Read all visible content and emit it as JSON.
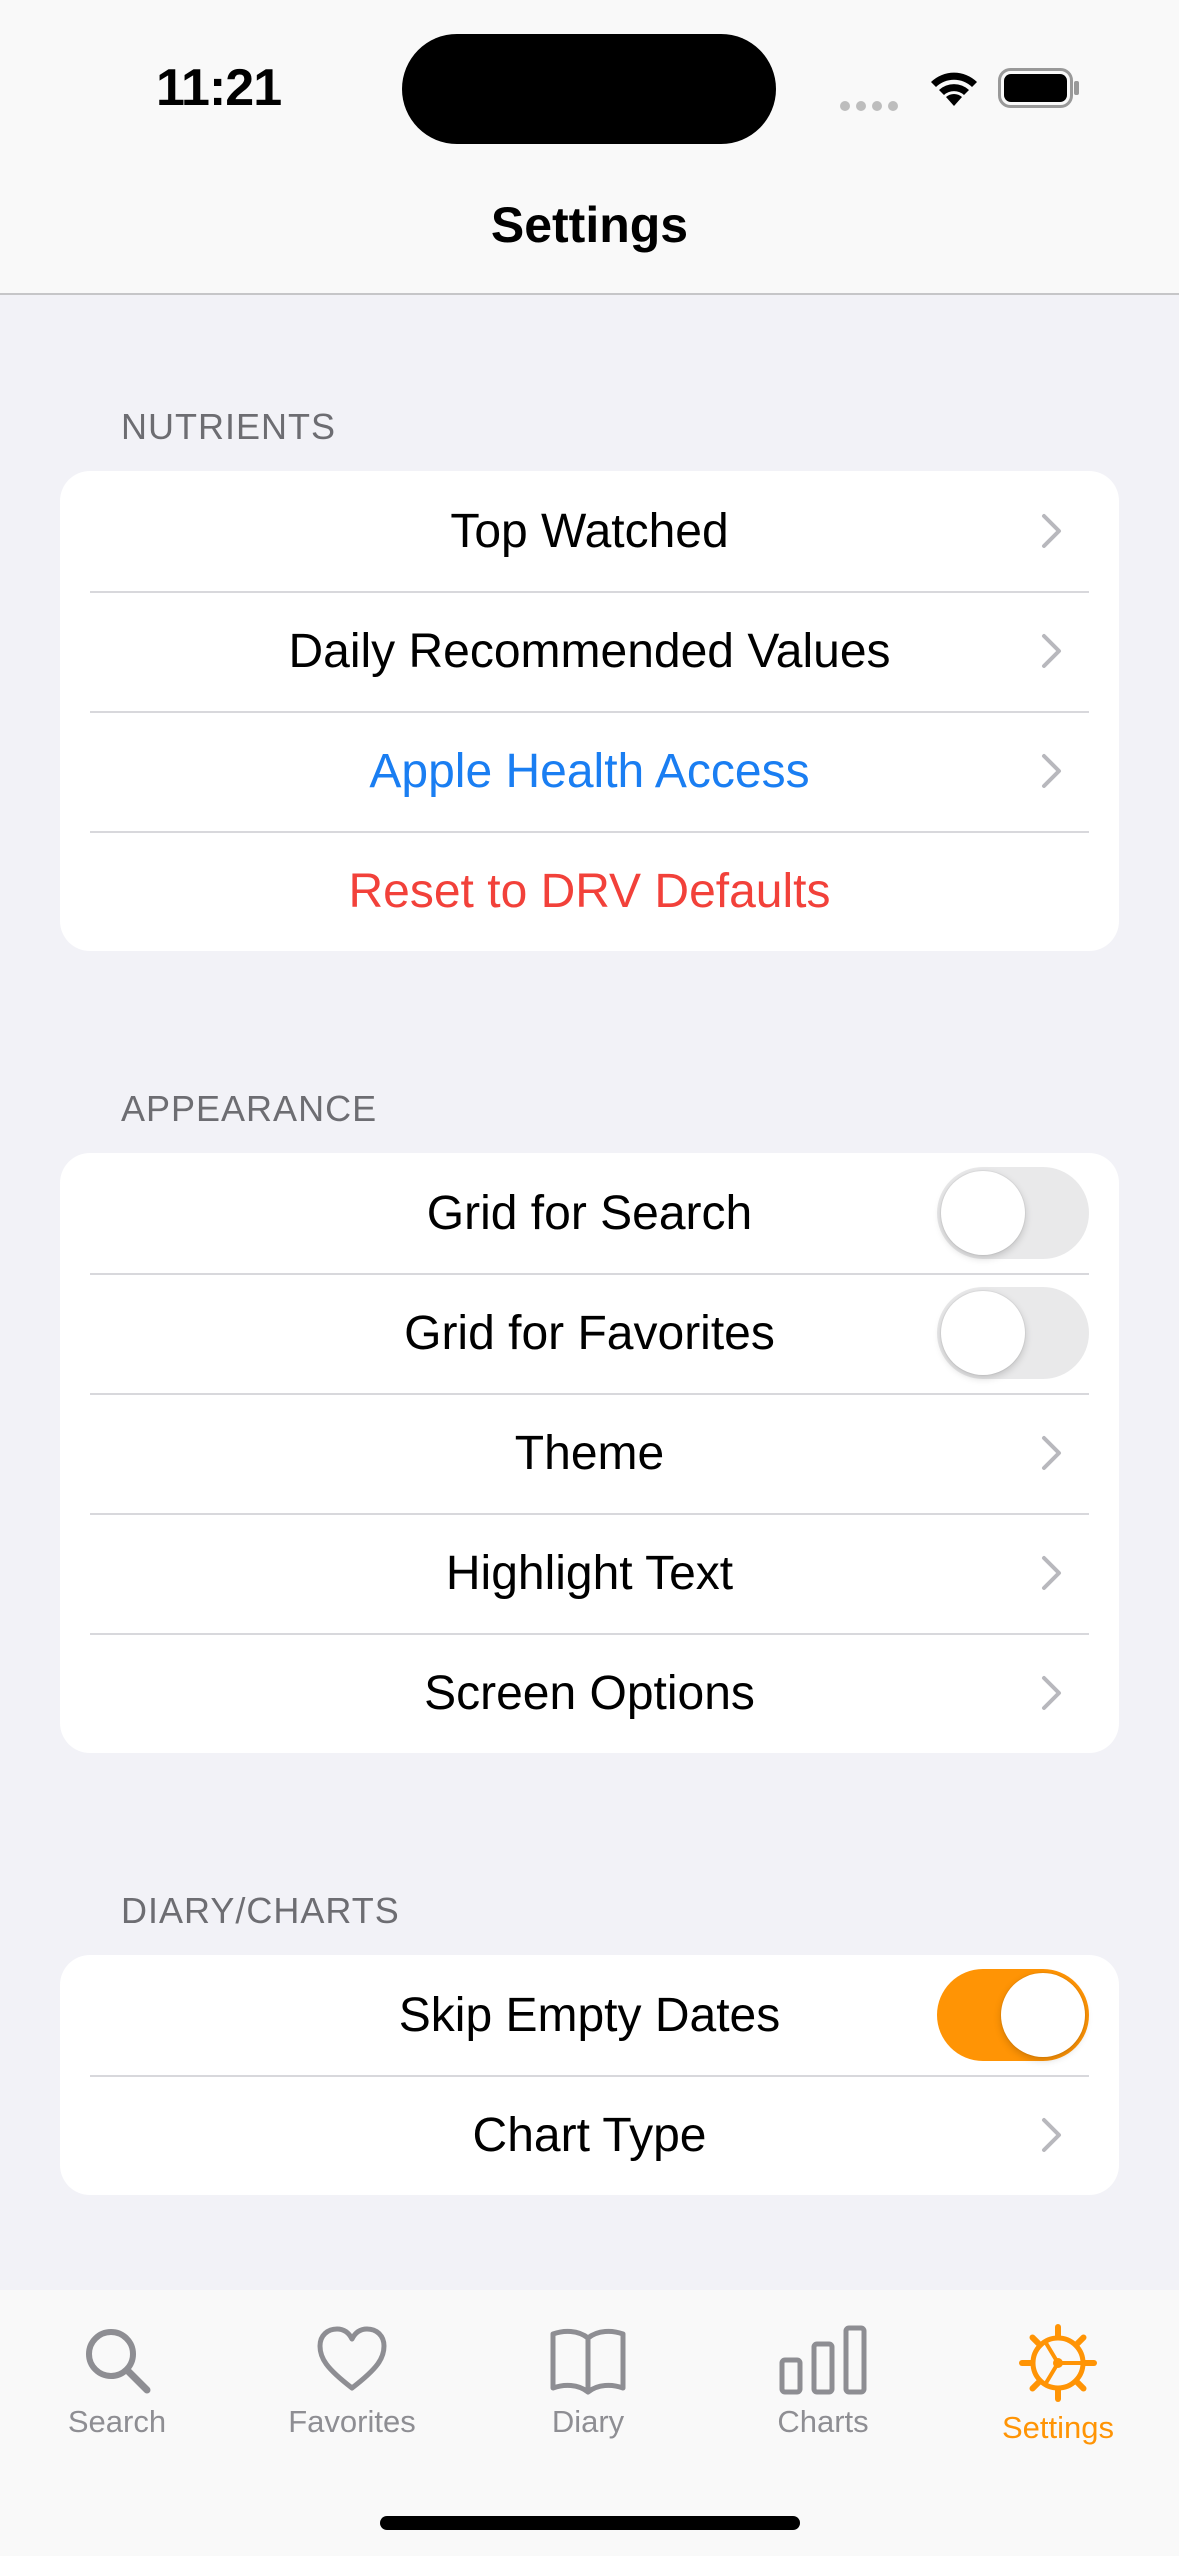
{
  "status_bar": {
    "time": "11:21"
  },
  "nav": {
    "title": "Settings"
  },
  "sections": {
    "nutrients": {
      "header": "NUTRIENTS",
      "rows": [
        {
          "label": "Top Watched"
        },
        {
          "label": "Daily Recommended Values"
        },
        {
          "label": "Apple Health Access",
          "color": "#1a7ef2"
        },
        {
          "label": "Reset to DRV Defaults",
          "color": "#f2413a"
        }
      ]
    },
    "appearance": {
      "header": "APPEARANCE",
      "rows": [
        {
          "label": "Grid for Search",
          "toggle": false
        },
        {
          "label": "Grid for Favorites",
          "toggle": false
        },
        {
          "label": "Theme"
        },
        {
          "label": "Highlight Text"
        },
        {
          "label": "Screen Options"
        }
      ]
    },
    "diary_charts": {
      "header": "DIARY/CHARTS",
      "rows": [
        {
          "label": "Skip Empty Dates",
          "toggle": true
        },
        {
          "label": "Chart Type"
        }
      ]
    }
  },
  "tabs": [
    {
      "label": "Search",
      "icon": "magnifier-icon"
    },
    {
      "label": "Favorites",
      "icon": "heart-icon"
    },
    {
      "label": "Diary",
      "icon": "book-icon"
    },
    {
      "label": "Charts",
      "icon": "bar-chart-icon"
    },
    {
      "label": "Settings",
      "icon": "gear-icon",
      "active": true
    }
  ],
  "colors": {
    "accent": "#ff9405",
    "link_blue": "#1a7ef2",
    "destructive_red": "#f2413a",
    "background": "#f2f2f7"
  }
}
